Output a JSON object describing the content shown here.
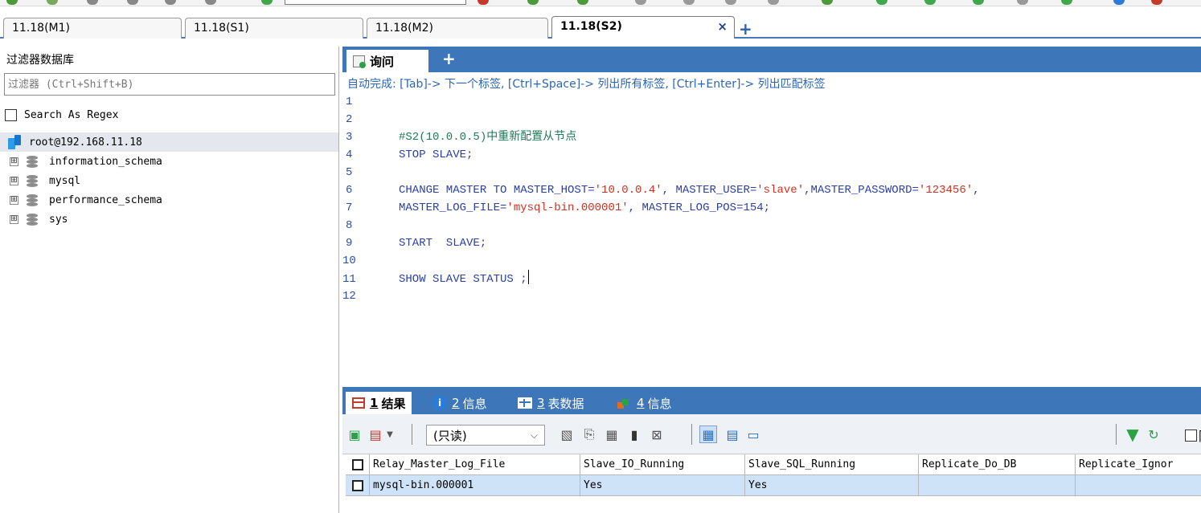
{
  "connection_tabs": [
    {
      "label": "11.18(M1)",
      "active": false
    },
    {
      "label": "11.18(S1)",
      "active": false
    },
    {
      "label": "11.18(M2)",
      "active": false
    },
    {
      "label": "11.18(S2)",
      "active": true
    }
  ],
  "connection_tab_close": "×",
  "new_tab_symbol": "+",
  "left_panel": {
    "title": "过滤器数据库",
    "filter_placeholder": "过滤器 (Ctrl+Shift+B)",
    "regex_label": "Search As Regex",
    "root_connection": "root@192.168.11.18",
    "databases": [
      "information_schema",
      "mysql",
      "performance_schema",
      "sys"
    ],
    "expander_symbol": "⊞"
  },
  "query": {
    "tab_label": "询问",
    "add_symbol": "+",
    "autocomplete_hint": "自动完成: [Tab]-> 下一个标签, [Ctrl+Space]-> 列出所有标签, [Ctrl+Enter]-> 列出匹配标签",
    "line_numbers": [
      "1",
      "2",
      "3",
      "4",
      "5",
      "6",
      "7",
      "8",
      "9",
      "10",
      "11",
      "12"
    ],
    "lines": {
      "l3": "#S2(10.0.0.5)中重新配置从节点",
      "l4": "STOP SLAVE;",
      "l6a": "CHANGE MASTER TO MASTER_HOST=",
      "l6b": "'10.0.0.4'",
      "l6c": ", MASTER_USER=",
      "l6d": "'slave'",
      "l6e": ",MASTER_PASSWORD=",
      "l6f": "'123456'",
      "l6g": ",",
      "l7a": "MASTER_LOG_FILE=",
      "l7b": "'mysql-bin.000001'",
      "l7c": ", MASTER_LOG_POS=154;",
      "l9": "START  SLAVE;",
      "l11": "SHOW SLAVE STATUS ;"
    }
  },
  "results_tabs": [
    {
      "num": "1",
      "label": "结果",
      "active": true
    },
    {
      "num": "2",
      "label": "信息",
      "active": false
    },
    {
      "num": "3",
      "label": "表数据",
      "active": false
    },
    {
      "num": "4",
      "label": "信息",
      "active": false
    }
  ],
  "results_toolbar": {
    "readonly_option": "(只读)",
    "hidden_label": "隐"
  },
  "results_grid": {
    "columns": [
      "Relay_Master_Log_File",
      "Slave_IO_Running",
      "Slave_SQL_Running",
      "Replicate_Do_DB",
      "Replicate_Ignor"
    ],
    "rows": [
      [
        "mysql-bin.000001",
        "Yes",
        "Yes",
        "",
        ""
      ]
    ]
  },
  "colors": {
    "accent_blue": "#3d76b9",
    "selected_row": "#cfe3f8",
    "string_red": "#d0301f",
    "keyword_blue": "#2b3fa8",
    "comment_green": "#1f7a56"
  }
}
